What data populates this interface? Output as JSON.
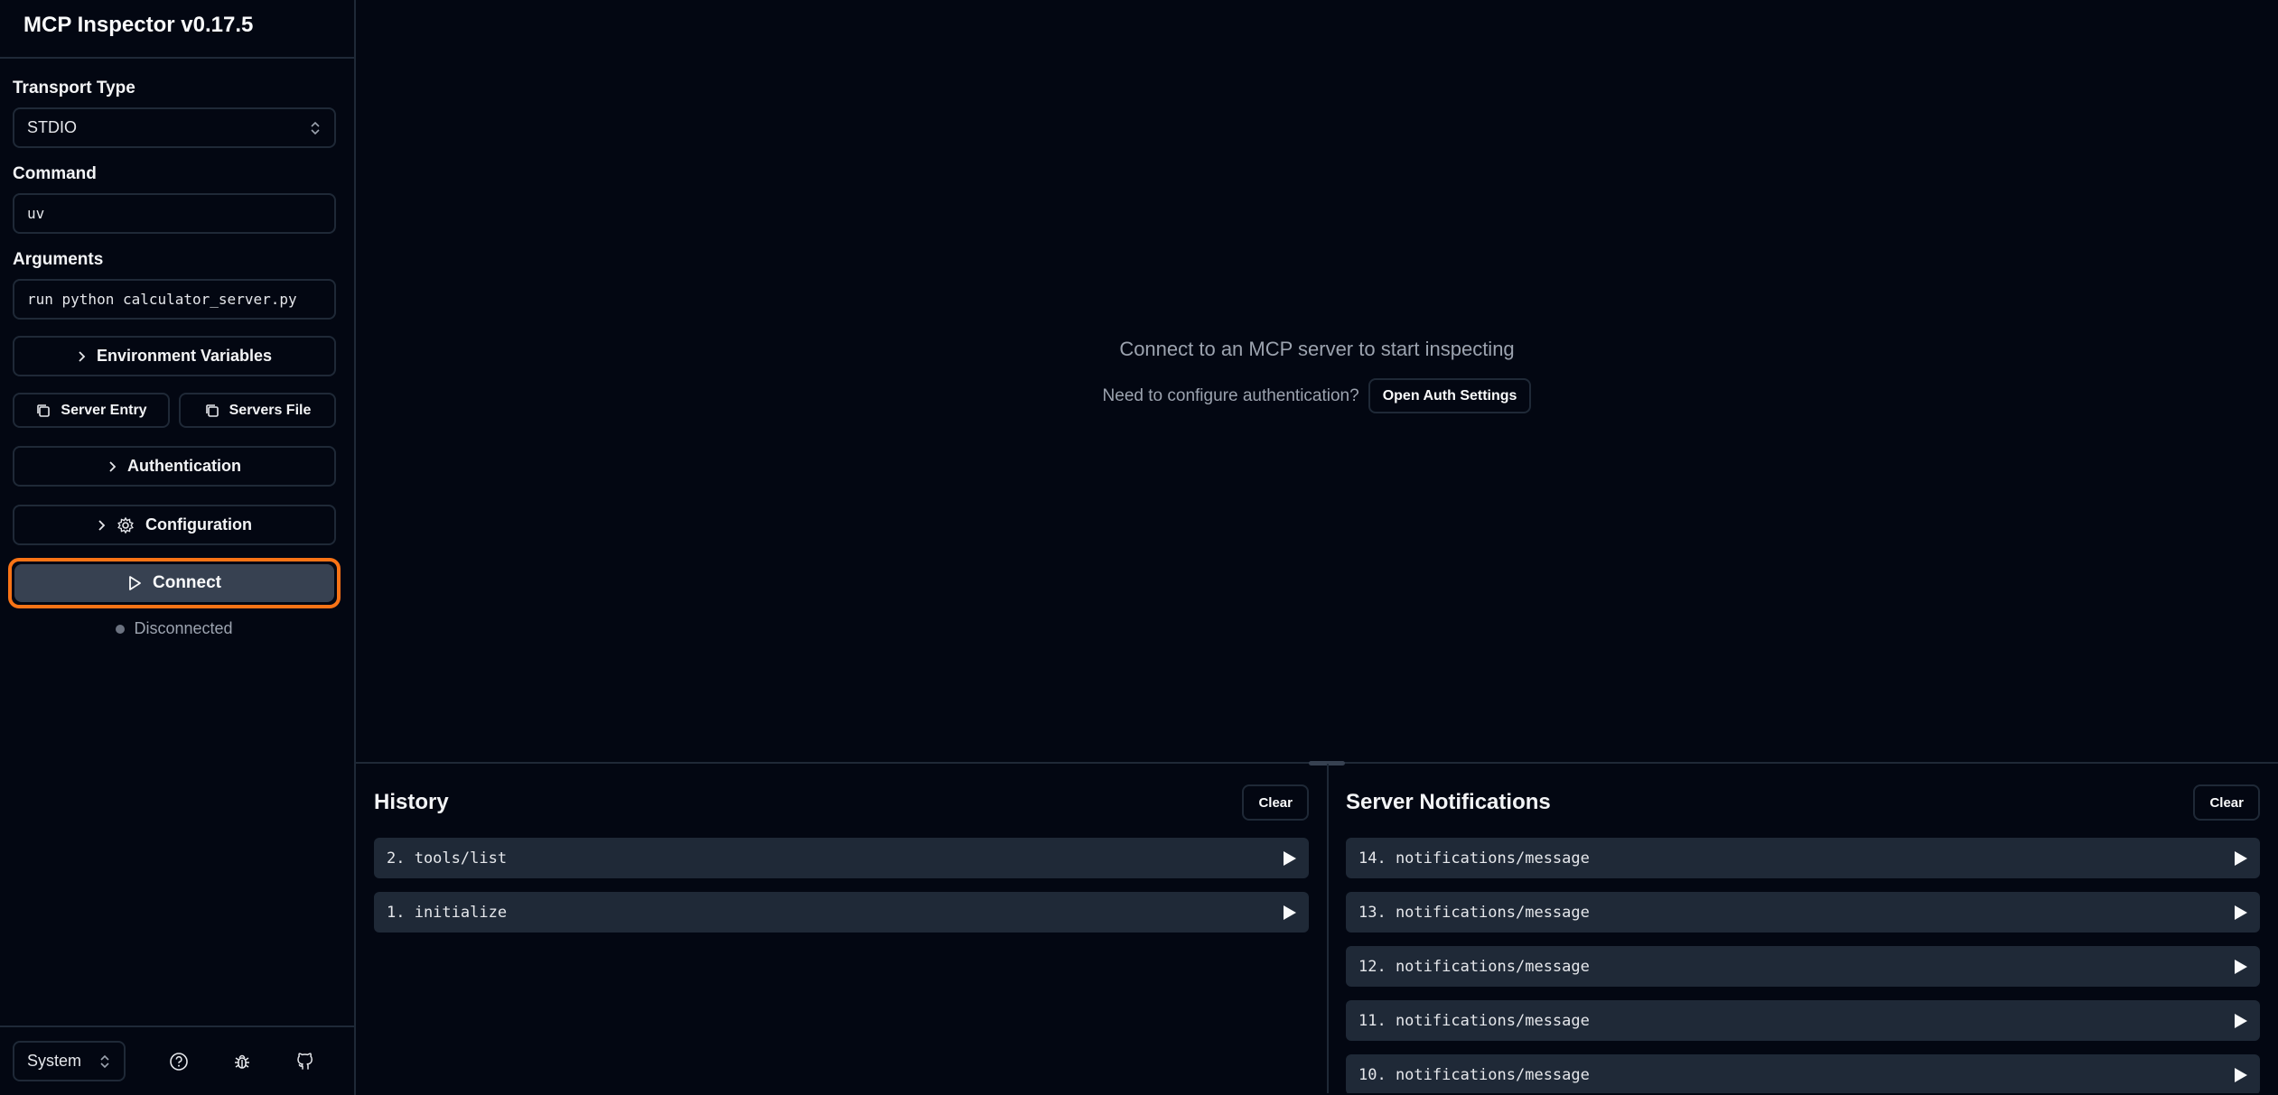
{
  "app": {
    "title": "MCP Inspector v0.17.5"
  },
  "sidebar": {
    "transport_label": "Transport Type",
    "transport_value": "STDIO",
    "command_label": "Command",
    "command_value": "uv",
    "arguments_label": "Arguments",
    "arguments_value": "run python calculator_server.py",
    "env_label": "Environment Variables",
    "server_entry_label": "Server Entry",
    "servers_file_label": "Servers File",
    "auth_label": "Authentication",
    "config_label": "Configuration",
    "connect_label": "Connect",
    "status_text": "Disconnected",
    "theme_value": "System"
  },
  "main": {
    "empty_title": "Connect to an MCP server to start inspecting",
    "auth_prompt": "Need to configure authentication?",
    "auth_button": "Open Auth Settings"
  },
  "history": {
    "title": "History",
    "clear_label": "Clear",
    "items": [
      "2. tools/list",
      "1. initialize"
    ]
  },
  "notifications": {
    "title": "Server Notifications",
    "clear_label": "Clear",
    "items": [
      "14. notifications/message",
      "13. notifications/message",
      "12. notifications/message",
      "11. notifications/message",
      "10. notifications/message"
    ]
  },
  "colors": {
    "background": "#030712",
    "border": "#1f2937",
    "highlight": "#f97316",
    "connect_bg": "#374151"
  }
}
